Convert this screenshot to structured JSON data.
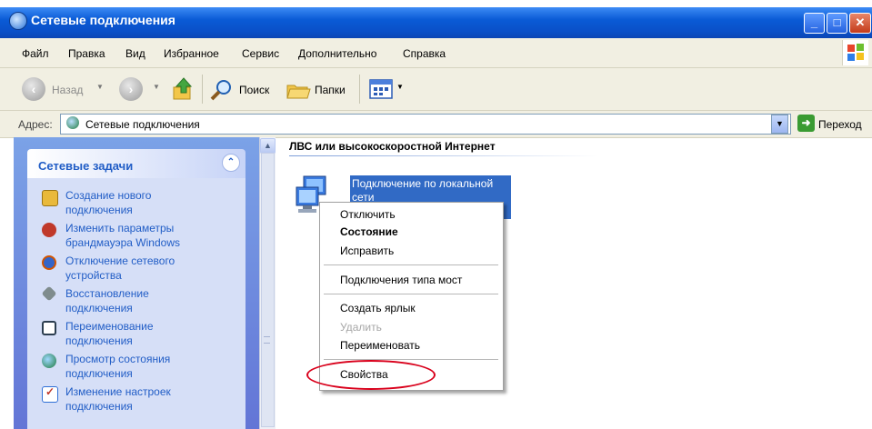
{
  "window": {
    "title": "Сетевые подключения"
  },
  "menu": [
    "Файл",
    "Правка",
    "Вид",
    "Избранное",
    "Сервис",
    "Дополнительно",
    "Справка"
  ],
  "toolbar": {
    "back_label": "Назад",
    "search_label": "Поиск",
    "folders_label": "Папки"
  },
  "address": {
    "label": "Адрес:",
    "value": "Сетевые подключения",
    "go_label": "Переход"
  },
  "tasks": {
    "title": "Сетевые задачи",
    "items": [
      {
        "line1": "Создание нового",
        "line2": "подключения",
        "icon": "new-connection-icon",
        "color": "#e9b93b"
      },
      {
        "line1": "Изменить параметры",
        "line2": "брандмауэра Windows",
        "icon": "firewall-icon",
        "color": "#c0392b"
      },
      {
        "line1": "Отключение сетевого",
        "line2": "устройства",
        "icon": "network-disable-icon",
        "color": "#d35400"
      },
      {
        "line1": "Восстановление",
        "line2": "подключения",
        "icon": "repair-icon",
        "color": "#7f8c8d"
      },
      {
        "line1": "Переименование",
        "line2": "подключения",
        "icon": "rename-icon",
        "color": "#2c3e50"
      },
      {
        "line1": "Просмотр состояния",
        "line2": "подключения",
        "icon": "status-icon",
        "color": "#1e7a3c"
      },
      {
        "line1": "Изменение настроек",
        "line2": "подключения",
        "icon": "settings-icon",
        "color": "#2f6fd6"
      }
    ]
  },
  "main": {
    "group_title": "ЛВС или высокоскоростной Интернет",
    "connection_label": "Подключение по локальной сети"
  },
  "context_menu": {
    "items": [
      "Отключить",
      "Состояние",
      "Исправить",
      "Подключения типа мост",
      "Создать ярлык",
      "Удалить",
      "Переименовать",
      "Свойства"
    ]
  }
}
